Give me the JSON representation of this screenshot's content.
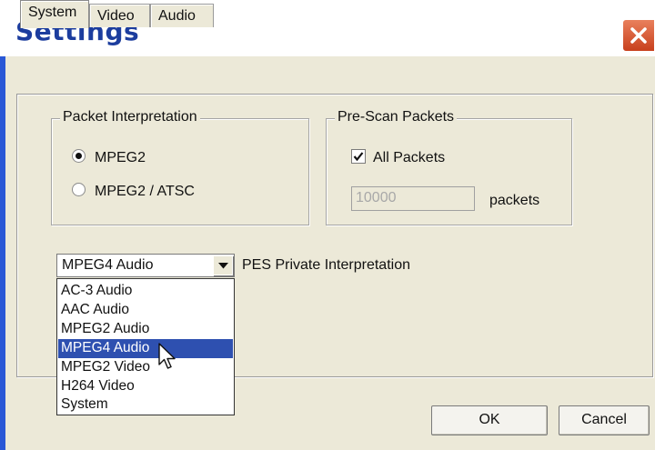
{
  "window": {
    "title": "Settings"
  },
  "tabs": [
    {
      "label": "System",
      "active": true
    },
    {
      "label": "Video",
      "active": false
    },
    {
      "label": "Audio",
      "active": false
    }
  ],
  "packet_interpretation": {
    "legend": "Packet Interpretation",
    "options": [
      {
        "label": "MPEG2",
        "selected": true
      },
      {
        "label": "MPEG2 / ATSC",
        "selected": false
      }
    ]
  },
  "prescan": {
    "legend": "Pre-Scan Packets",
    "all_packets_label": "All Packets",
    "all_packets_checked": true,
    "packet_count": "10000",
    "packets_unit": "packets"
  },
  "pes": {
    "selected": "MPEG4 Audio",
    "label": "PES Private Interpretation",
    "options": [
      "AC-3 Audio",
      "AAC Audio",
      "MPEG2 Audio",
      "MPEG4 Audio",
      "MPEG2 Video",
      "H264 Video",
      "System"
    ],
    "highlighted": "MPEG4 Audio"
  },
  "buttons": {
    "ok": "OK",
    "cancel": "Cancel"
  },
  "colors": {
    "title": "#1c3d9e",
    "frame": "#2a58d6",
    "highlight": "#2e50b0",
    "close": "#d9552f"
  }
}
